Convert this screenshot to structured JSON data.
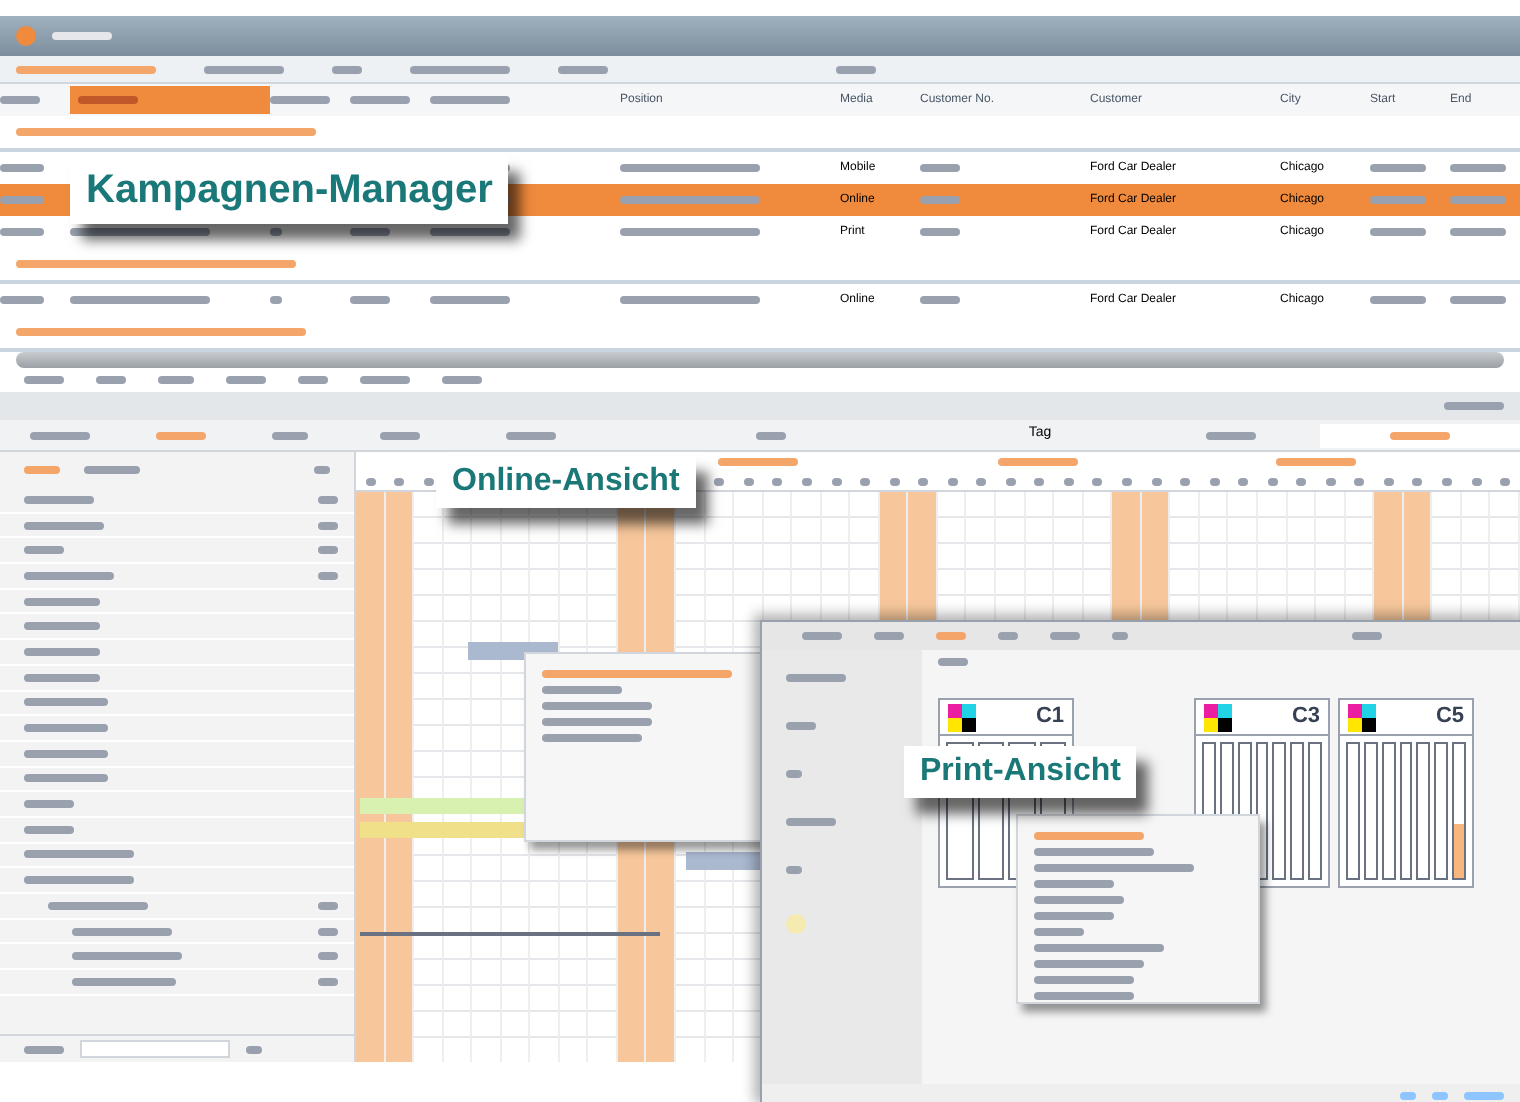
{
  "callouts": [
    {
      "text": "Kampagnen-Manager"
    },
    {
      "text": "Online-Ansicht"
    },
    {
      "text": "Print-Ansicht"
    }
  ],
  "campaign_table": {
    "columns": [
      "Position",
      "Media",
      "Customer No.",
      "Customer",
      "City",
      "Start",
      "End"
    ],
    "groups": [
      {
        "rows": [
          {
            "media": "Mobile",
            "customer": "Ford Car Dealer",
            "city": "Chicago",
            "selected": false
          },
          {
            "media": "Online",
            "customer": "Ford Car Dealer",
            "city": "Chicago",
            "selected": true
          },
          {
            "media": "Print",
            "customer": "Ford Car Dealer",
            "city": "Chicago",
            "selected": false
          }
        ]
      },
      {
        "rows": [
          {
            "media": "Online",
            "customer": "Ford Car Dealer",
            "city": "Chicago",
            "selected": false
          }
        ]
      }
    ]
  },
  "timeline": {
    "view_tabs": [
      {
        "label": "Tag"
      }
    ]
  },
  "print_view": {
    "columns": [
      {
        "label": "C1"
      },
      {
        "label": "C3"
      },
      {
        "label": "C5"
      }
    ]
  }
}
